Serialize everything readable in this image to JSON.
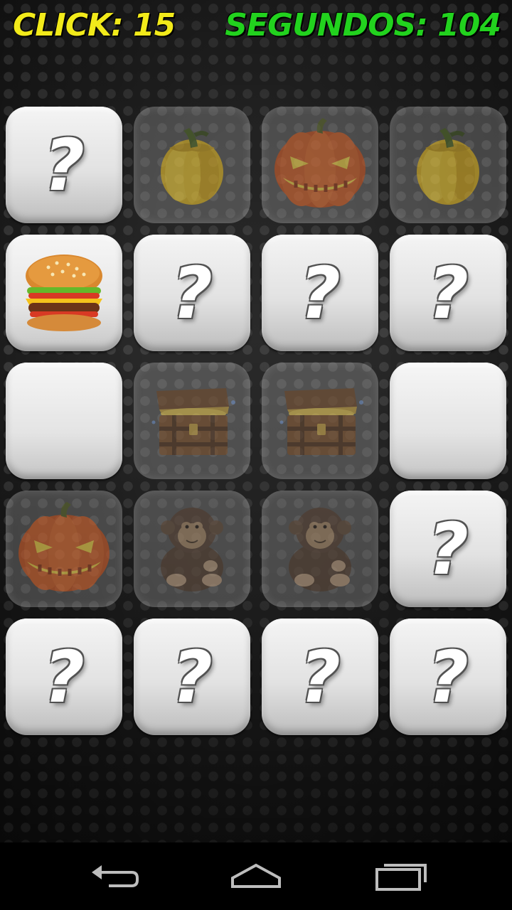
{
  "hud": {
    "clicks_text": "CLICK: 15",
    "seconds_text": "SEGUNDOS: 104"
  },
  "colors": {
    "clicks": "#f2ea1a",
    "seconds": "#22d21e"
  },
  "board": {
    "columns": 4,
    "rows": 5,
    "cards": [
      {
        "state": "hidden",
        "content": "?",
        "icon": "question-mark"
      },
      {
        "state": "matched",
        "icon": "yellow-pepper-icon"
      },
      {
        "state": "matched",
        "icon": "pumpkin-icon"
      },
      {
        "state": "matched",
        "icon": "yellow-pepper-icon"
      },
      {
        "state": "revealed",
        "icon": "burger-icon"
      },
      {
        "state": "hidden",
        "content": "?",
        "icon": "question-mark"
      },
      {
        "state": "hidden",
        "content": "?",
        "icon": "question-mark"
      },
      {
        "state": "hidden",
        "content": "?",
        "icon": "question-mark"
      },
      {
        "state": "empty",
        "icon": ""
      },
      {
        "state": "matched",
        "icon": "treasure-chest-icon"
      },
      {
        "state": "matched",
        "icon": "treasure-chest-icon"
      },
      {
        "state": "empty",
        "icon": ""
      },
      {
        "state": "matched",
        "icon": "pumpkin-icon"
      },
      {
        "state": "matched",
        "icon": "monkey-plush-icon"
      },
      {
        "state": "matched",
        "icon": "monkey-plush-icon"
      },
      {
        "state": "hidden",
        "content": "?",
        "icon": "question-mark"
      },
      {
        "state": "hidden",
        "content": "?",
        "icon": "question-mark"
      },
      {
        "state": "hidden",
        "content": "?",
        "icon": "question-mark"
      },
      {
        "state": "hidden",
        "content": "?",
        "icon": "question-mark"
      },
      {
        "state": "hidden",
        "content": "?",
        "icon": "question-mark"
      }
    ]
  },
  "navbar": {
    "buttons": [
      "back-icon",
      "home-icon",
      "recents-icon"
    ]
  }
}
